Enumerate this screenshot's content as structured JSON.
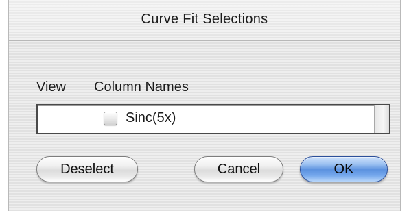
{
  "dialog": {
    "title": "Curve Fit Selections"
  },
  "list": {
    "header_view": "View",
    "header_column_names": "Column Names",
    "items": [
      {
        "label": "Sinc(5x)",
        "checked": false
      }
    ]
  },
  "buttons": {
    "deselect": "Deselect",
    "cancel": "Cancel",
    "ok": "OK"
  },
  "colors": {
    "default_button": "#5c92df",
    "background_stripe_light": "#eeeeee",
    "background_stripe_dark": "#e1e1e1"
  }
}
